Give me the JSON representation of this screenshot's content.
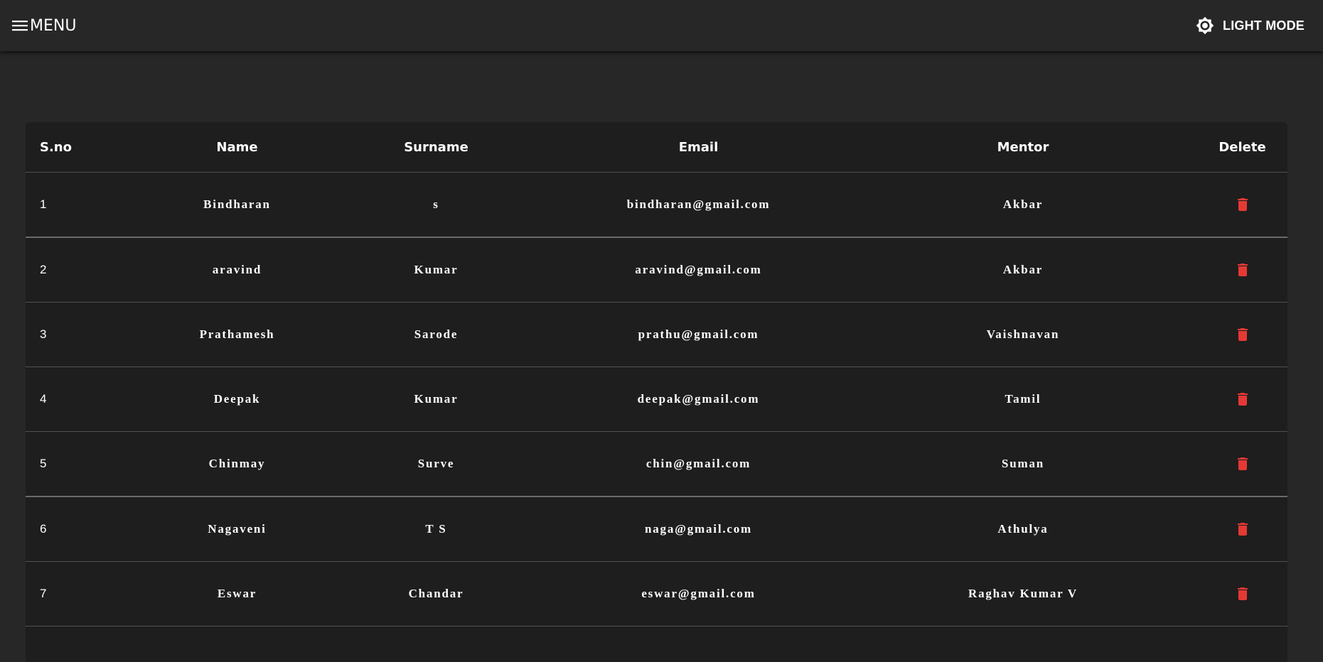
{
  "appbar": {
    "menu_label": "MENU",
    "mode_label": "LIGHT MODE",
    "icons": {
      "menu": "hamburger-icon",
      "mode": "brightness-icon"
    }
  },
  "colors": {
    "background": "#272727",
    "table_background": "#1e1e1e",
    "delete_icon": "#e53935",
    "text": "#ffffff"
  },
  "table": {
    "headers": [
      "S.no",
      "Name",
      "Surname",
      "Email",
      "Mentor",
      "Delete"
    ],
    "rows": [
      {
        "sno": "1",
        "name": "Bindharan",
        "surname": "s",
        "email": "bindharan@gmail.com",
        "mentor": "Akbar"
      },
      {
        "sno": "2",
        "name": "aravind",
        "surname": "Kumar",
        "email": "aravind@gmail.com",
        "mentor": "Akbar"
      },
      {
        "sno": "3",
        "name": "Prathamesh",
        "surname": "Sarode",
        "email": "prathu@gmail.com",
        "mentor": "Vaishnavan"
      },
      {
        "sno": "4",
        "name": "Deepak",
        "surname": "Kumar",
        "email": "deepak@gmail.com",
        "mentor": "Tamil"
      },
      {
        "sno": "5",
        "name": "Chinmay",
        "surname": "Surve",
        "email": "chin@gmail.com",
        "mentor": "Suman"
      },
      {
        "sno": "6",
        "name": "Nagaveni",
        "surname": "T S",
        "email": "naga@gmail.com",
        "mentor": "Athulya"
      },
      {
        "sno": "7",
        "name": "Eswar",
        "surname": "Chandar",
        "email": "eswar@gmail.com",
        "mentor": "Raghav Kumar V"
      }
    ]
  }
}
